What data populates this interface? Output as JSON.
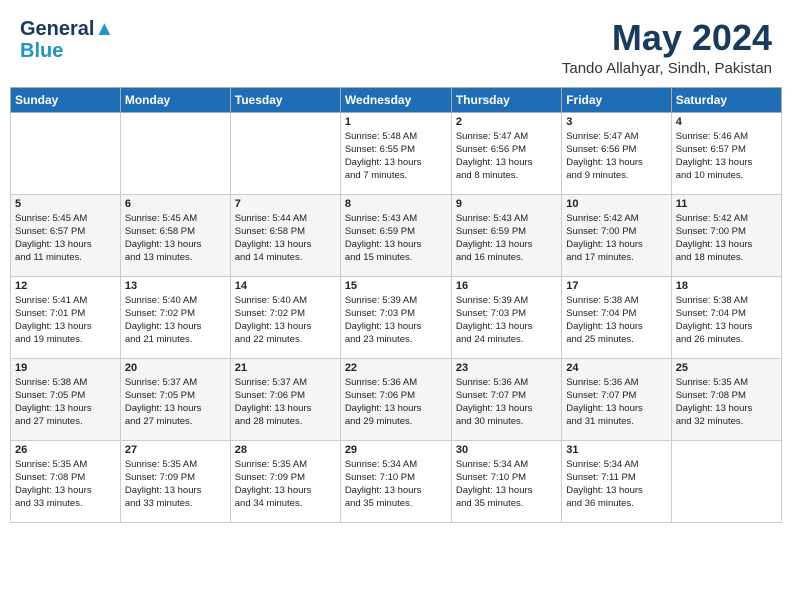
{
  "header": {
    "logo_line1": "General",
    "logo_line2": "Blue",
    "month": "May 2024",
    "location": "Tando Allahyar, Sindh, Pakistan"
  },
  "weekdays": [
    "Sunday",
    "Monday",
    "Tuesday",
    "Wednesday",
    "Thursday",
    "Friday",
    "Saturday"
  ],
  "weeks": [
    [
      {
        "day": "",
        "info": ""
      },
      {
        "day": "",
        "info": ""
      },
      {
        "day": "",
        "info": ""
      },
      {
        "day": "1",
        "info": "Sunrise: 5:48 AM\nSunset: 6:55 PM\nDaylight: 13 hours\nand 7 minutes."
      },
      {
        "day": "2",
        "info": "Sunrise: 5:47 AM\nSunset: 6:56 PM\nDaylight: 13 hours\nand 8 minutes."
      },
      {
        "day": "3",
        "info": "Sunrise: 5:47 AM\nSunset: 6:56 PM\nDaylight: 13 hours\nand 9 minutes."
      },
      {
        "day": "4",
        "info": "Sunrise: 5:46 AM\nSunset: 6:57 PM\nDaylight: 13 hours\nand 10 minutes."
      }
    ],
    [
      {
        "day": "5",
        "info": "Sunrise: 5:45 AM\nSunset: 6:57 PM\nDaylight: 13 hours\nand 11 minutes."
      },
      {
        "day": "6",
        "info": "Sunrise: 5:45 AM\nSunset: 6:58 PM\nDaylight: 13 hours\nand 13 minutes."
      },
      {
        "day": "7",
        "info": "Sunrise: 5:44 AM\nSunset: 6:58 PM\nDaylight: 13 hours\nand 14 minutes."
      },
      {
        "day": "8",
        "info": "Sunrise: 5:43 AM\nSunset: 6:59 PM\nDaylight: 13 hours\nand 15 minutes."
      },
      {
        "day": "9",
        "info": "Sunrise: 5:43 AM\nSunset: 6:59 PM\nDaylight: 13 hours\nand 16 minutes."
      },
      {
        "day": "10",
        "info": "Sunrise: 5:42 AM\nSunset: 7:00 PM\nDaylight: 13 hours\nand 17 minutes."
      },
      {
        "day": "11",
        "info": "Sunrise: 5:42 AM\nSunset: 7:00 PM\nDaylight: 13 hours\nand 18 minutes."
      }
    ],
    [
      {
        "day": "12",
        "info": "Sunrise: 5:41 AM\nSunset: 7:01 PM\nDaylight: 13 hours\nand 19 minutes."
      },
      {
        "day": "13",
        "info": "Sunrise: 5:40 AM\nSunset: 7:02 PM\nDaylight: 13 hours\nand 21 minutes."
      },
      {
        "day": "14",
        "info": "Sunrise: 5:40 AM\nSunset: 7:02 PM\nDaylight: 13 hours\nand 22 minutes."
      },
      {
        "day": "15",
        "info": "Sunrise: 5:39 AM\nSunset: 7:03 PM\nDaylight: 13 hours\nand 23 minutes."
      },
      {
        "day": "16",
        "info": "Sunrise: 5:39 AM\nSunset: 7:03 PM\nDaylight: 13 hours\nand 24 minutes."
      },
      {
        "day": "17",
        "info": "Sunrise: 5:38 AM\nSunset: 7:04 PM\nDaylight: 13 hours\nand 25 minutes."
      },
      {
        "day": "18",
        "info": "Sunrise: 5:38 AM\nSunset: 7:04 PM\nDaylight: 13 hours\nand 26 minutes."
      }
    ],
    [
      {
        "day": "19",
        "info": "Sunrise: 5:38 AM\nSunset: 7:05 PM\nDaylight: 13 hours\nand 27 minutes."
      },
      {
        "day": "20",
        "info": "Sunrise: 5:37 AM\nSunset: 7:05 PM\nDaylight: 13 hours\nand 27 minutes."
      },
      {
        "day": "21",
        "info": "Sunrise: 5:37 AM\nSunset: 7:06 PM\nDaylight: 13 hours\nand 28 minutes."
      },
      {
        "day": "22",
        "info": "Sunrise: 5:36 AM\nSunset: 7:06 PM\nDaylight: 13 hours\nand 29 minutes."
      },
      {
        "day": "23",
        "info": "Sunrise: 5:36 AM\nSunset: 7:07 PM\nDaylight: 13 hours\nand 30 minutes."
      },
      {
        "day": "24",
        "info": "Sunrise: 5:36 AM\nSunset: 7:07 PM\nDaylight: 13 hours\nand 31 minutes."
      },
      {
        "day": "25",
        "info": "Sunrise: 5:35 AM\nSunset: 7:08 PM\nDaylight: 13 hours\nand 32 minutes."
      }
    ],
    [
      {
        "day": "26",
        "info": "Sunrise: 5:35 AM\nSunset: 7:08 PM\nDaylight: 13 hours\nand 33 minutes."
      },
      {
        "day": "27",
        "info": "Sunrise: 5:35 AM\nSunset: 7:09 PM\nDaylight: 13 hours\nand 33 minutes."
      },
      {
        "day": "28",
        "info": "Sunrise: 5:35 AM\nSunset: 7:09 PM\nDaylight: 13 hours\nand 34 minutes."
      },
      {
        "day": "29",
        "info": "Sunrise: 5:34 AM\nSunset: 7:10 PM\nDaylight: 13 hours\nand 35 minutes."
      },
      {
        "day": "30",
        "info": "Sunrise: 5:34 AM\nSunset: 7:10 PM\nDaylight: 13 hours\nand 35 minutes."
      },
      {
        "day": "31",
        "info": "Sunrise: 5:34 AM\nSunset: 7:11 PM\nDaylight: 13 hours\nand 36 minutes."
      },
      {
        "day": "",
        "info": ""
      }
    ]
  ]
}
